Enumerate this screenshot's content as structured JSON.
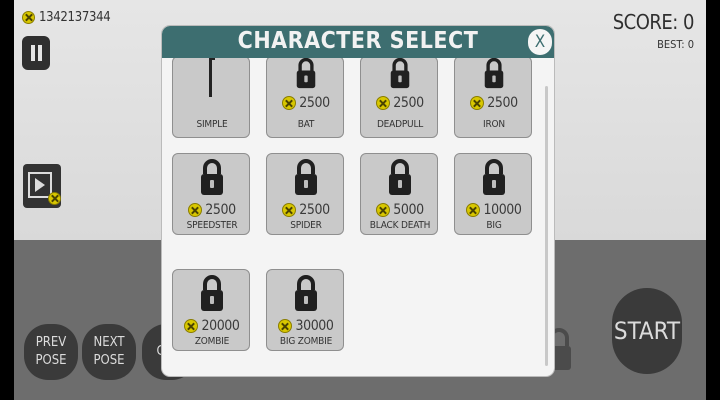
{
  "hud": {
    "coins": "1342137344",
    "score": "SCORE: 0",
    "best": "BEST: 0"
  },
  "controls": {
    "prev_pose": "PREV\nPOSE",
    "next_pose": "NEXT\nPOSE",
    "char": "CHA",
    "start": "START"
  },
  "dialog": {
    "title": "CHARACTER SELECT",
    "close_label": "X",
    "characters": [
      {
        "name": "SIMPLE",
        "price": "",
        "locked": false
      },
      {
        "name": "BAT",
        "price": "2500",
        "locked": true
      },
      {
        "name": "DEADPULL",
        "price": "2500",
        "locked": true
      },
      {
        "name": "IRON",
        "price": "2500",
        "locked": true
      },
      {
        "name": "SPEEDSTER",
        "price": "2500",
        "locked": true
      },
      {
        "name": "SPIDER",
        "price": "2500",
        "locked": true
      },
      {
        "name": "BLACK DEATH",
        "price": "5000",
        "locked": true
      },
      {
        "name": "BIG",
        "price": "10000",
        "locked": true
      },
      {
        "name": "ZOMBIE",
        "price": "20000",
        "locked": true
      },
      {
        "name": "BIG ZOMBIE",
        "price": "30000",
        "locked": true
      }
    ]
  },
  "colors": {
    "header": "#3d6e70",
    "card": "#c9c9c9",
    "coin": "#d8c700"
  }
}
